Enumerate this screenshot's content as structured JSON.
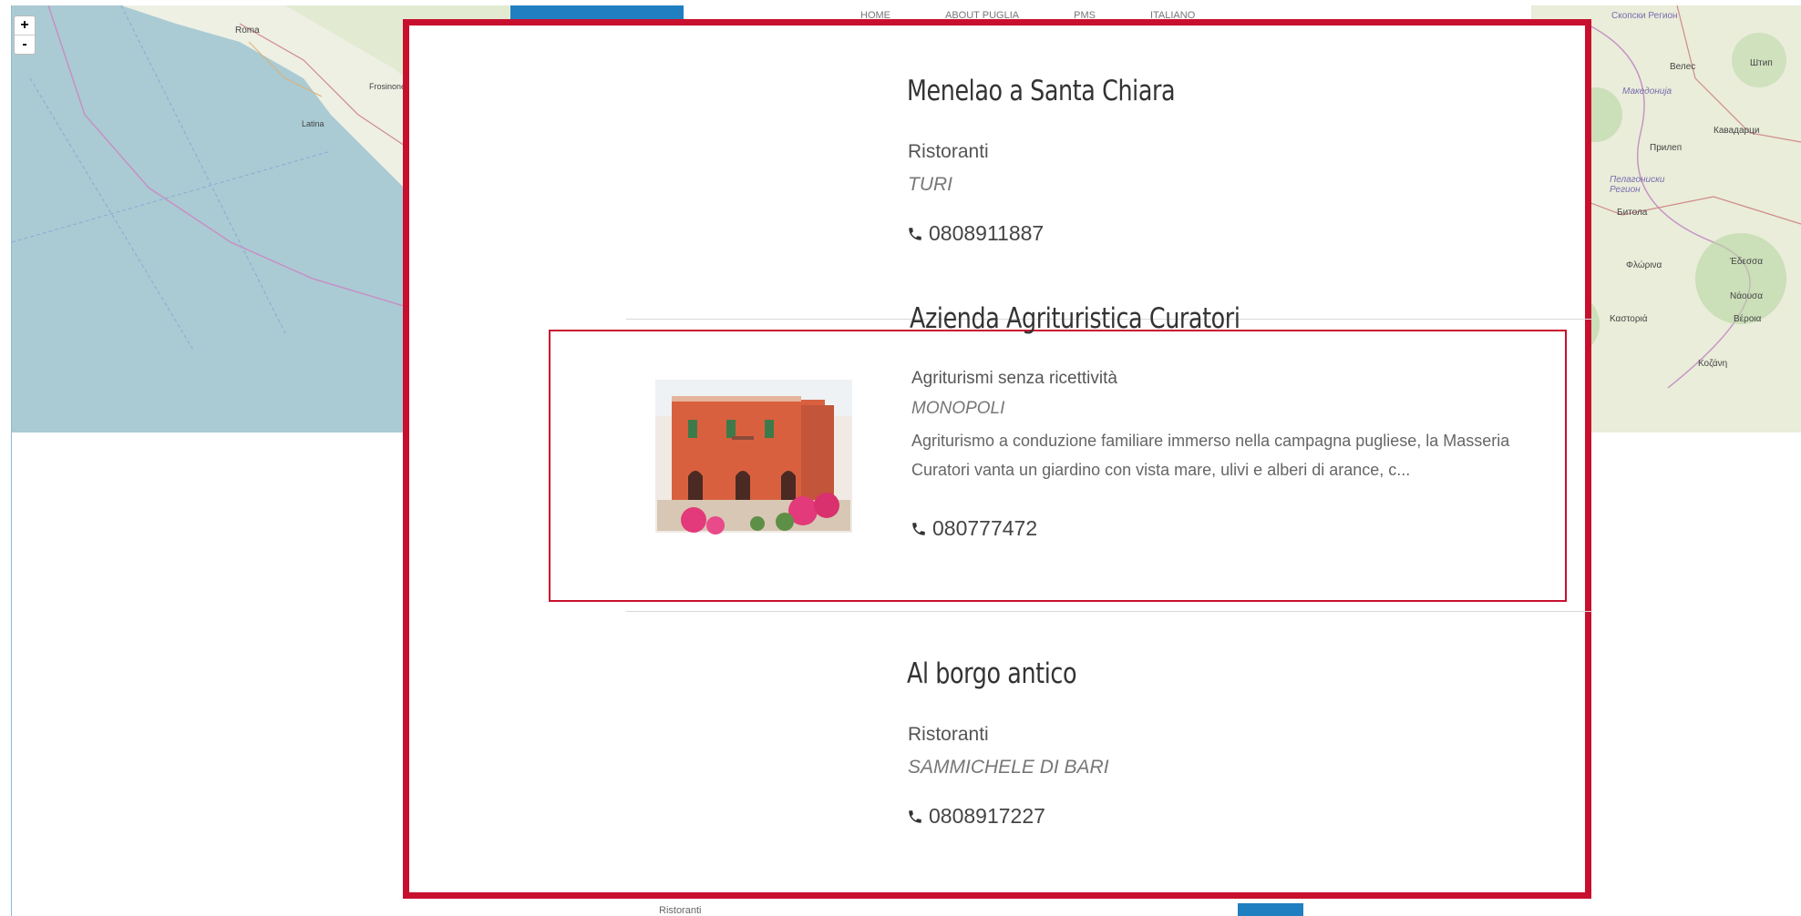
{
  "map": {
    "zoom_in": "+",
    "zoom_out": "-",
    "labels_left": [
      "Roma",
      "Frosinone",
      "Latina"
    ],
    "labels_right": [
      "Скопски Регион",
      "Велес",
      "Штип",
      "Македонија",
      "Прилеп",
      "Кавадарци",
      "Пелагониски Регион",
      "Битола",
      "Φλώρινα",
      "Καστοριά",
      "Έδεσσα",
      "Νάουσα",
      "Βέροια",
      "Κοζάνη"
    ]
  },
  "nav": {
    "items": [
      "HOME",
      "ABOUT PUGLIA",
      "PMS",
      "ITALIANO"
    ]
  },
  "entries": [
    {
      "title": "Menelao a Santa Chiara",
      "category": "Ristoranti",
      "city": "TURI",
      "phone": "0808911887"
    },
    {
      "title": "Azienda Agrituristica Curatori",
      "category": "Agriturismi senza ricettività",
      "city": "MONOPOLI",
      "description": "Agriturismo a conduzione familiare immerso nella campagna pugliese, la Masseria Curatori vanta un giardino con vista mare, ulivi e alberi di arance, c...",
      "phone": "080777472",
      "image": "farmhouse-photo"
    },
    {
      "title": "Al borgo antico",
      "category": "Ristoranti",
      "city": "SAMMICHELE DI BARI",
      "phone": "0808917227"
    }
  ],
  "below": {
    "category": "Ristoranti"
  },
  "colors": {
    "highlight": "#c8102e",
    "accent_blue": "#1f7fc1"
  }
}
